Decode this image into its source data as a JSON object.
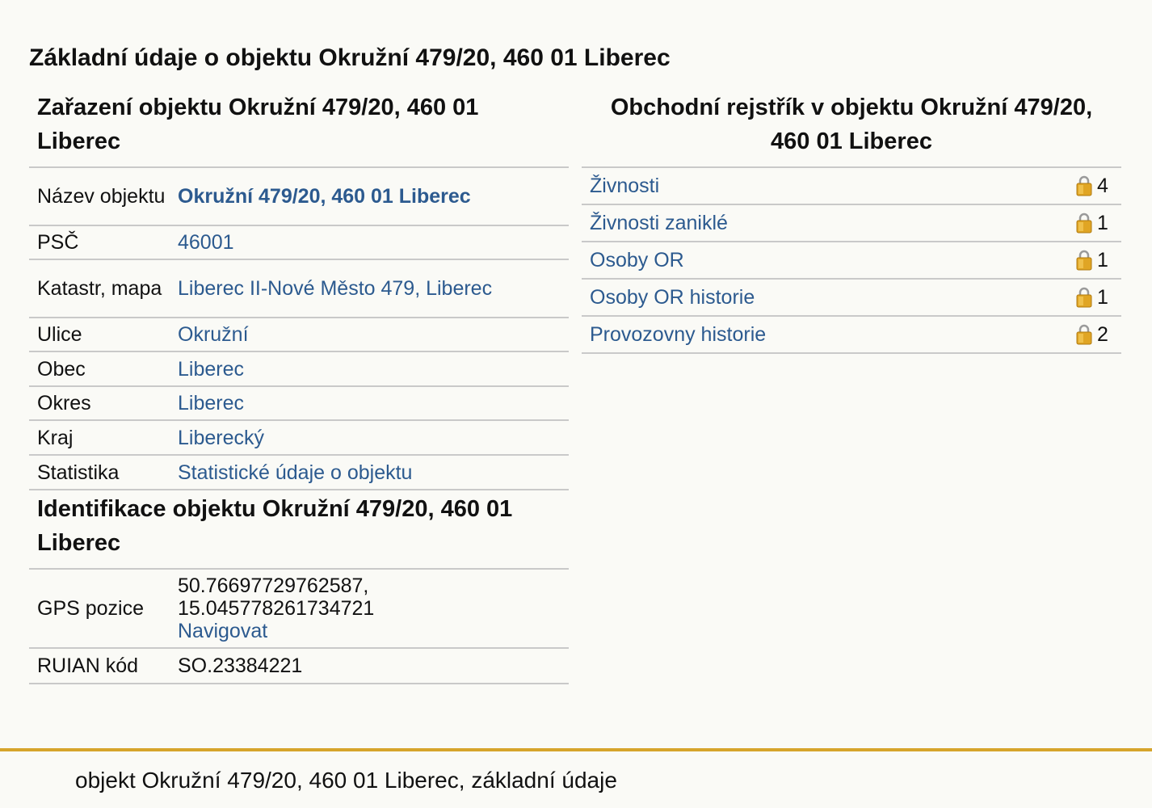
{
  "page_title": "Základní údaje o objektu Okružní 479/20, 460 01 Liberec",
  "classification": {
    "title": "Zařazení objektu Okružní 479/20, 460 01 Liberec",
    "rows": [
      {
        "label": "Název objektu",
        "value": "Okružní 479/20, 460 01 Liberec"
      },
      {
        "label": "PSČ",
        "value": "46001"
      },
      {
        "label": "Katastr, mapa",
        "value": "Liberec II-Nové Město 479, Liberec"
      },
      {
        "label": "Ulice",
        "value": "Okružní"
      },
      {
        "label": "Obec",
        "value": "Liberec"
      },
      {
        "label": "Okres",
        "value": "Liberec"
      },
      {
        "label": "Kraj",
        "value": "Liberecký"
      },
      {
        "label": "Statistika",
        "value": "Statistické údaje o objektu"
      }
    ]
  },
  "identification": {
    "title": "Identifikace objektu Okružní 479/20, 460 01 Liberec",
    "gps": {
      "label": "GPS pozice",
      "lat": "50.76697729762587,",
      "lon": "15.045778261734721",
      "navigate": "Navigovat"
    },
    "ruian": {
      "label": "RUIAN kód",
      "value": "SO.23384221"
    }
  },
  "register": {
    "title": "Obchodní rejstřík v objektu Okružní 479/20, 460 01 Liberec",
    "items": [
      {
        "label": "Živnosti",
        "count": "4",
        "icon": "lock-icon"
      },
      {
        "label": "Živnosti zaniklé",
        "count": "1",
        "icon": "lock-icon"
      },
      {
        "label": "Osoby OR",
        "count": "1",
        "icon": "lock-icon"
      },
      {
        "label": "Osoby OR historie",
        "count": "1",
        "icon": "lock-icon"
      },
      {
        "label": "Provozovny historie",
        "count": "2",
        "icon": "lock-icon"
      }
    ]
  },
  "footer": {
    "text": "objekt Okružní 479/20, 460 01 Liberec, základní údaje"
  },
  "colors": {
    "link": "#2c5a8f",
    "background": "#fafaf6",
    "divider": "#c9c9c9",
    "footer_accent": "#d6a42b",
    "lock_gold": "#e0a524"
  }
}
